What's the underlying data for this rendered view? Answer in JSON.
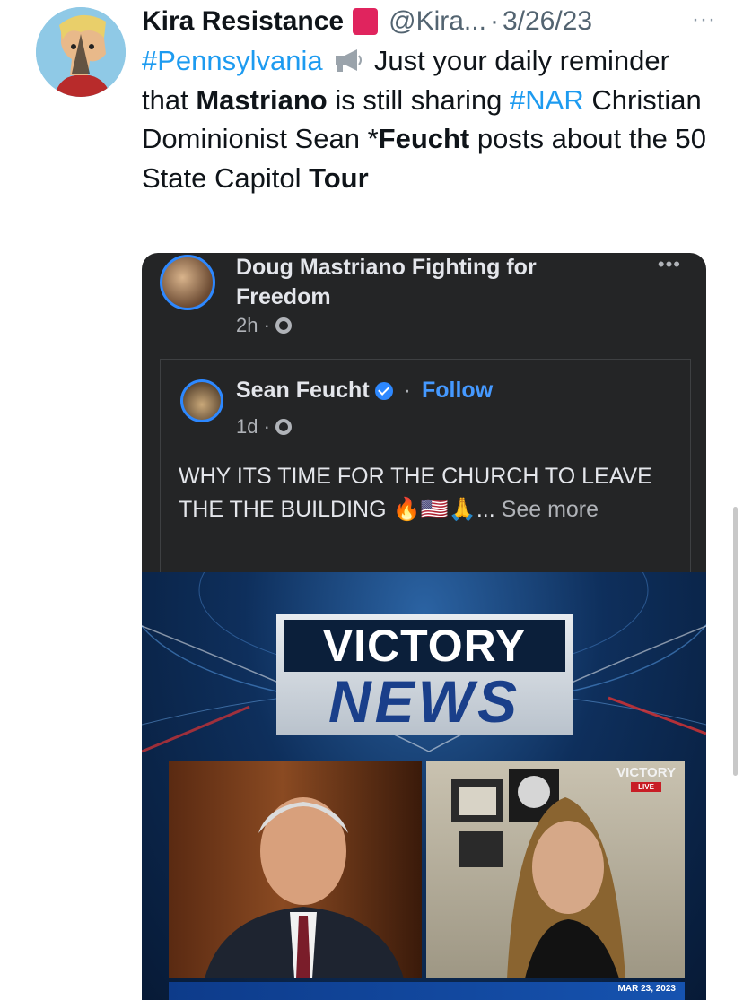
{
  "tweet": {
    "display_name": "Kira Resistance",
    "handle": "@Kira...",
    "separator": "·",
    "date": "3/26/23",
    "more": "···",
    "body": {
      "hashtag1": "#Pennsylvania",
      "t1": " Just your daily reminder that ",
      "b1": "Mastriano",
      "t2": " is still sharing ",
      "hashtag2": "#NAR",
      "t3": " Christian Dominionist Sean *",
      "b2": "Feucht",
      "t4": " posts about the 50 State Capitol ",
      "b3": "Tour"
    }
  },
  "embed": {
    "page_name": "Doug Mastriano Fighting for Freedom",
    "page_time": "2h ·",
    "more": "•••",
    "shared": {
      "author": "Sean Feucht",
      "dot": "·",
      "follow": "Follow",
      "time": "1d ·",
      "text": "WHY ITS TIME FOR THE CHURCH TO LEAVE THE THE BUILDING 🔥🇺🇸🙏... ",
      "see_more": "See more"
    },
    "video": {
      "logo_top": "VICTORY",
      "logo_bottom": "NEWS",
      "corner_brand": "VICTORY",
      "corner_live": "LIVE",
      "date": "MAR 23, 2023"
    }
  },
  "icons": {
    "avatar": "avatar-icon",
    "siren": "siren-icon",
    "megaphone": "megaphone-icon",
    "globe": "globe-icon",
    "verified": "verified-badge-icon"
  },
  "colors": {
    "link": "#1d9bf0",
    "fb_dark": "#242526",
    "fb_follow": "#4599ff"
  }
}
